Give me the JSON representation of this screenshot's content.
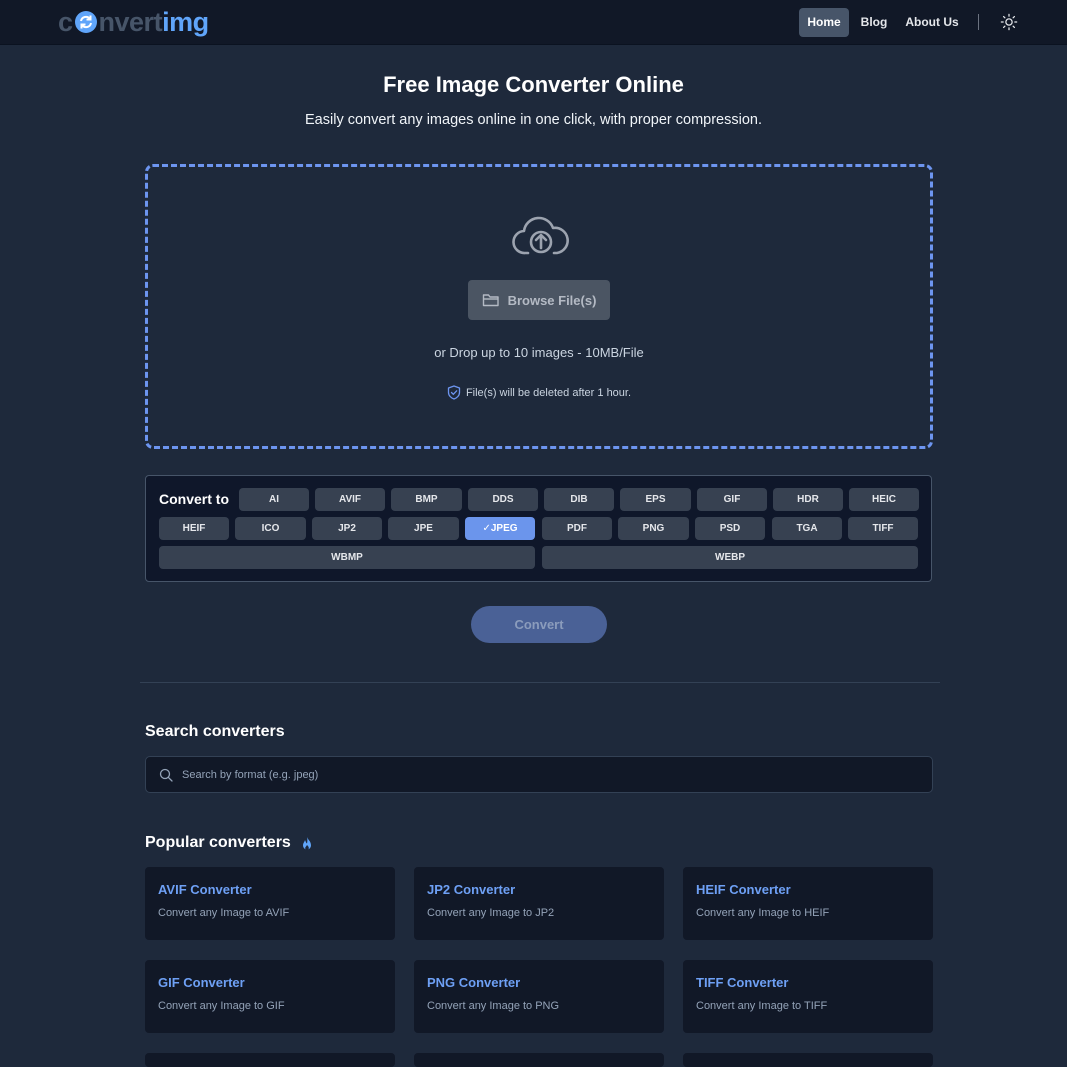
{
  "header": {
    "logo_part1": "c",
    "logo_part2": "nvert",
    "logo_part3": "img",
    "nav": [
      "Home",
      "Blog",
      "About Us"
    ]
  },
  "hero": {
    "title": "Free Image Converter Online",
    "subtitle": "Easily convert any images online in one click, with proper compression."
  },
  "dropzone": {
    "browse_label": "Browse File(s)",
    "drop_text": "or Drop up to 10 images - 10MB/File",
    "deleted_note": "File(s) will be deleted after 1 hour."
  },
  "convert_to": {
    "label": "Convert to",
    "formats": [
      "AI",
      "AVIF",
      "BMP",
      "DDS",
      "DIB",
      "EPS",
      "GIF",
      "HDR",
      "HEIC",
      "HEIF",
      "ICO",
      "JP2",
      "JPE",
      "✓JPEG",
      "PDF",
      "PNG",
      "PSD",
      "TGA",
      "TIFF",
      "WBMP",
      "WEBP"
    ],
    "selected": "JPEG"
  },
  "convert_button": "Convert",
  "search": {
    "title": "Search converters",
    "placeholder": "Search by format (e.g. jpeg)"
  },
  "popular": {
    "title": "Popular converters",
    "cards": [
      {
        "title": "AVIF Converter",
        "desc": "Convert any Image to AVIF"
      },
      {
        "title": "JP2 Converter",
        "desc": "Convert any Image to JP2"
      },
      {
        "title": "HEIF Converter",
        "desc": "Convert any Image to HEIF"
      },
      {
        "title": "GIF Converter",
        "desc": "Convert any Image to GIF"
      },
      {
        "title": "PNG Converter",
        "desc": "Convert any Image to PNG"
      },
      {
        "title": "TIFF Converter",
        "desc": "Convert any Image to TIFF"
      }
    ]
  },
  "colors": {
    "background": "#1e293b",
    "accent": "#6b95ec",
    "link": "#6ea0f5"
  },
  "icons": [
    "refresh-cycle-icon",
    "sun-icon",
    "cloud-upload-icon",
    "folder-icon",
    "shield-check-icon",
    "search-icon",
    "flame-icon"
  ]
}
